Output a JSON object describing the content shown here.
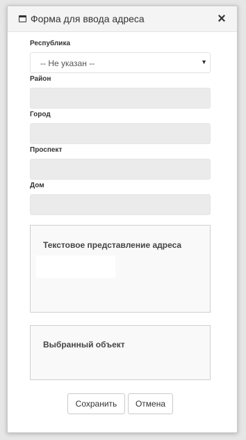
{
  "dialog": {
    "title": "Форма для ввода адреса",
    "icon": "window-icon",
    "close_icon": "close-icon"
  },
  "form": {
    "republic": {
      "label": "Республика",
      "value": "-- Не указан --"
    },
    "district": {
      "label": "Район",
      "value": ""
    },
    "city": {
      "label": "Город",
      "value": ""
    },
    "avenue": {
      "label": "Проспект",
      "value": ""
    },
    "house": {
      "label": "Дом",
      "value": ""
    }
  },
  "panels": {
    "text_representation": {
      "title": "Текстовое представление адреса"
    },
    "selected_object": {
      "title": "Выбранный объект"
    }
  },
  "buttons": {
    "save": "Сохранить",
    "cancel": "Отмена"
  }
}
